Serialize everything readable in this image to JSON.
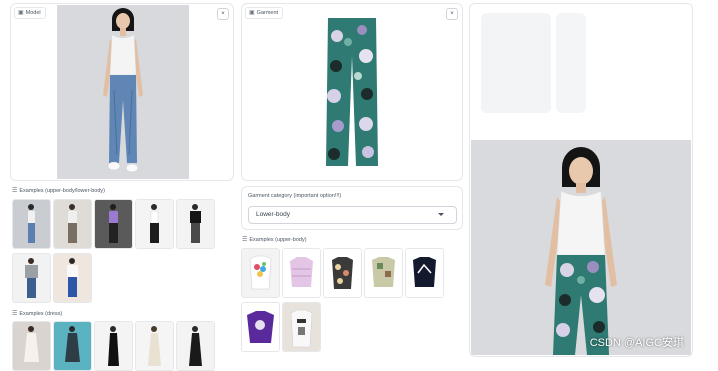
{
  "model_panel": {
    "label": "Model",
    "close": "×"
  },
  "garment_panel": {
    "label": "Garment",
    "close": "×"
  },
  "output_panel": {
    "download": "⤓",
    "close": "×"
  },
  "examples_upper_lower": {
    "label": "Examples (upper-body/lower-body)"
  },
  "examples_dress": {
    "label": "Examples (dress)"
  },
  "garment_category": {
    "label": "Garment category (important option!!!)",
    "value": "Lower-body"
  },
  "examples_upper": {
    "label": "Examples (upper-body)"
  },
  "watermark": "CSDN @AIGC安琪",
  "colors": {
    "border": "#e5e7eb",
    "text": "#374151"
  }
}
